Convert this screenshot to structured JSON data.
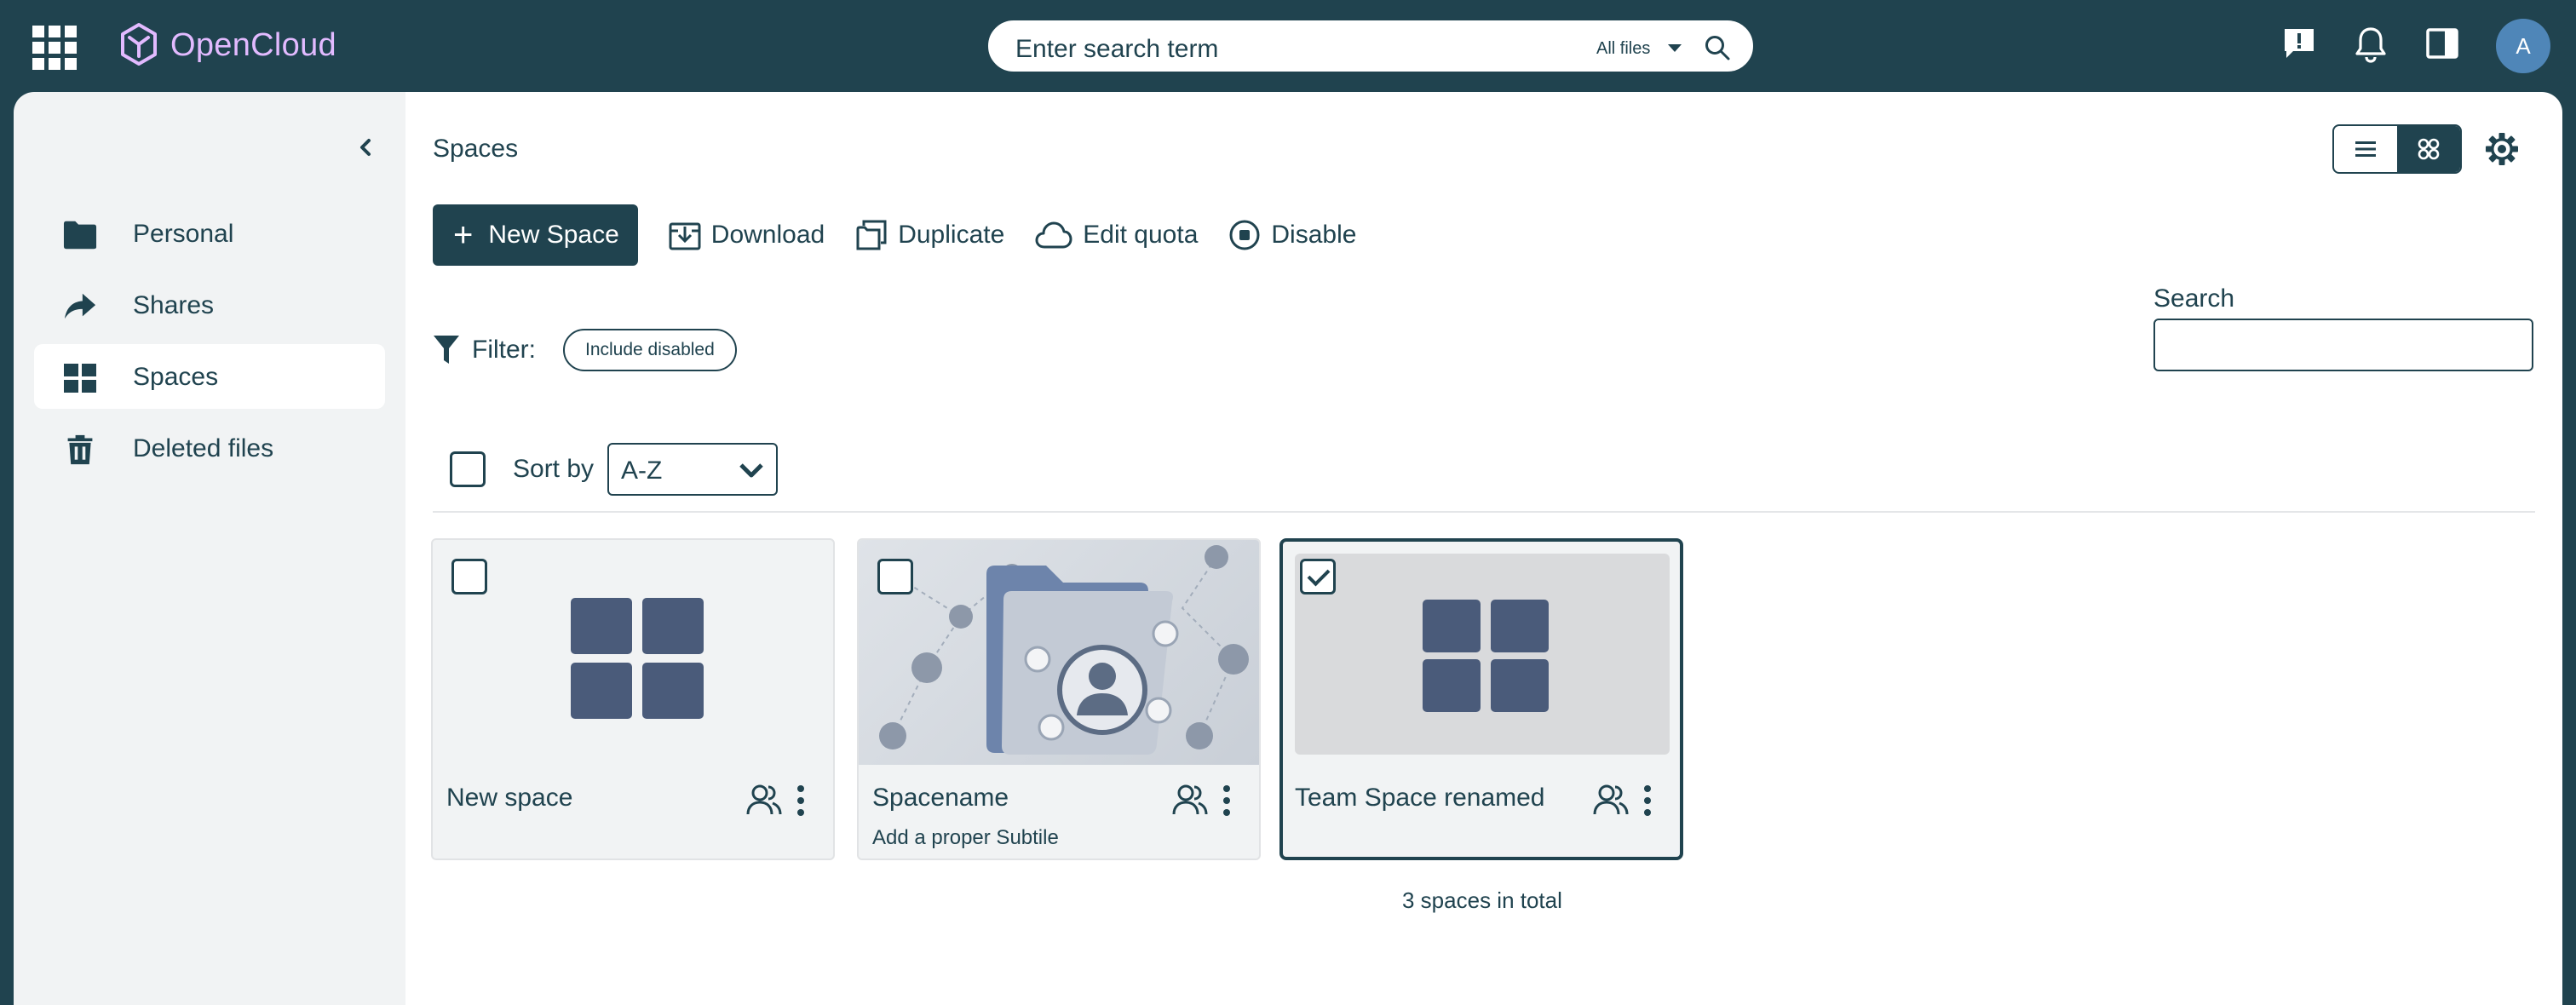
{
  "app": {
    "name": "OpenCloud"
  },
  "topbar": {
    "search_placeholder": "Enter search term",
    "search_scope": "All files",
    "avatar_initial": "A"
  },
  "sidebar": {
    "items": [
      {
        "label": "Personal",
        "icon": "folder-icon"
      },
      {
        "label": "Shares",
        "icon": "share-arrow-icon"
      },
      {
        "label": "Spaces",
        "icon": "spaces-grid-icon",
        "active": true
      },
      {
        "label": "Deleted files",
        "icon": "trash-icon"
      }
    ]
  },
  "main": {
    "breadcrumb": "Spaces",
    "actions": {
      "new_space": "New Space",
      "download": "Download",
      "duplicate": "Duplicate",
      "edit_quota": "Edit quota",
      "disable": "Disable"
    },
    "filter": {
      "label": "Filter:",
      "chip": "Include disabled"
    },
    "search": {
      "label": "Search",
      "value": ""
    },
    "sort": {
      "label": "Sort by",
      "value": "A-Z"
    },
    "cards": [
      {
        "title": "New space",
        "subtitle": "",
        "selected": false,
        "thumbnail": "spaces-grid-icon"
      },
      {
        "title": "Spacename",
        "subtitle": "Add a proper Subtile",
        "selected": false,
        "thumbnail": "folder-people-image"
      },
      {
        "title": "Team Space renamed",
        "subtitle": "",
        "selected": true,
        "thumbnail": "spaces-grid-icon"
      }
    ],
    "total": "3 spaces in total"
  },
  "colors": {
    "brand_dark": "#20434f",
    "logo_accent": "#e2baff",
    "avatar": "#4f86b8",
    "tile_icon": "#4a5b7a"
  }
}
